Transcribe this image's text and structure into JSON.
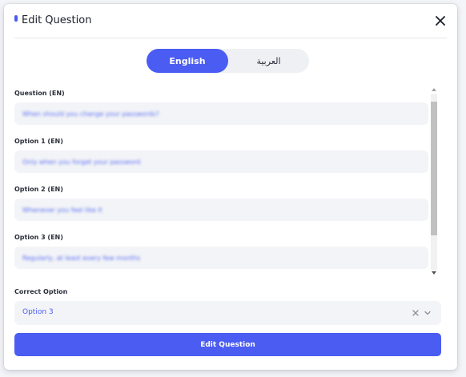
{
  "modal": {
    "title": "Edit Question"
  },
  "languages": {
    "english": "English",
    "arabic": "العربية",
    "active": "English"
  },
  "fields": [
    {
      "label": "Question (EN)",
      "value": "When should you change your passwords?"
    },
    {
      "label": "Option 1 (EN)",
      "value": "Only when you forget your password"
    },
    {
      "label": "Option 2 (EN)",
      "value": "Whenever you feel like it"
    },
    {
      "label": "Option 3 (EN)",
      "value": "Regularly, at least every few months"
    }
  ],
  "correct_option": {
    "label": "Correct Option",
    "value": "Option 3"
  },
  "submit": {
    "label": "Edit Question"
  },
  "colors": {
    "accent": "#4a5cf2",
    "field_bg": "#f3f4f7"
  },
  "icons": [
    "close-icon",
    "clear-icon",
    "chevron-down-icon",
    "scroll-up-icon",
    "scroll-down-icon"
  ]
}
